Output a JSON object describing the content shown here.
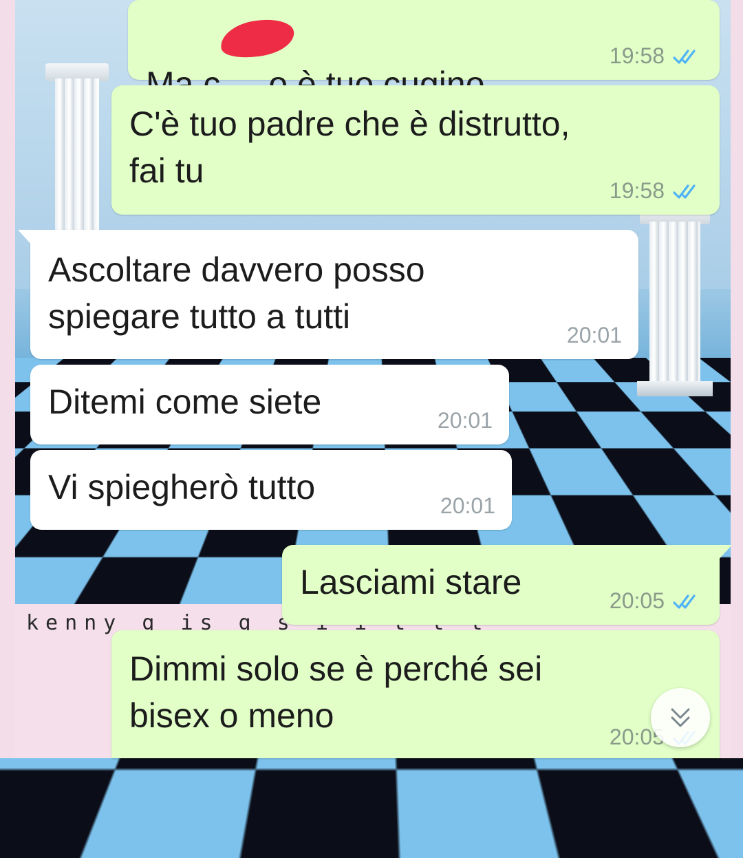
{
  "wallpaper": {
    "caption": "kenny  g  is  g  s  i  i  t  t  t"
  },
  "colors": {
    "outgoing_bubble": "#e1ffc7",
    "incoming_bubble": "#ffffff",
    "read_ticks": "#4fb3f6",
    "redaction": "#ee2c46"
  },
  "messages": [
    {
      "direction": "outgoing",
      "text_before": "Ma c",
      "text_after": "o è tuo cugino",
      "redacted": true,
      "time": "19:58",
      "status": "read"
    },
    {
      "direction": "outgoing",
      "text": "C'è tuo padre che è distrutto,\nfai tu",
      "time": "19:58",
      "status": "read"
    },
    {
      "direction": "incoming",
      "text": "Ascoltare davvero posso\nspiegare tutto a tutti",
      "time": "20:01"
    },
    {
      "direction": "incoming",
      "text": "Ditemi come siete",
      "time": "20:01"
    },
    {
      "direction": "incoming",
      "text": "Vi spiegherò tutto",
      "time": "20:01"
    },
    {
      "direction": "outgoing",
      "text": "Lasciami stare",
      "time": "20:05",
      "status": "read"
    },
    {
      "direction": "outgoing",
      "text": "Dimmi solo se è perché sei\nbisex o meno",
      "time": "20:05",
      "status": "read"
    }
  ],
  "scroll_button": {
    "icon": "double-chevron-down-icon"
  }
}
